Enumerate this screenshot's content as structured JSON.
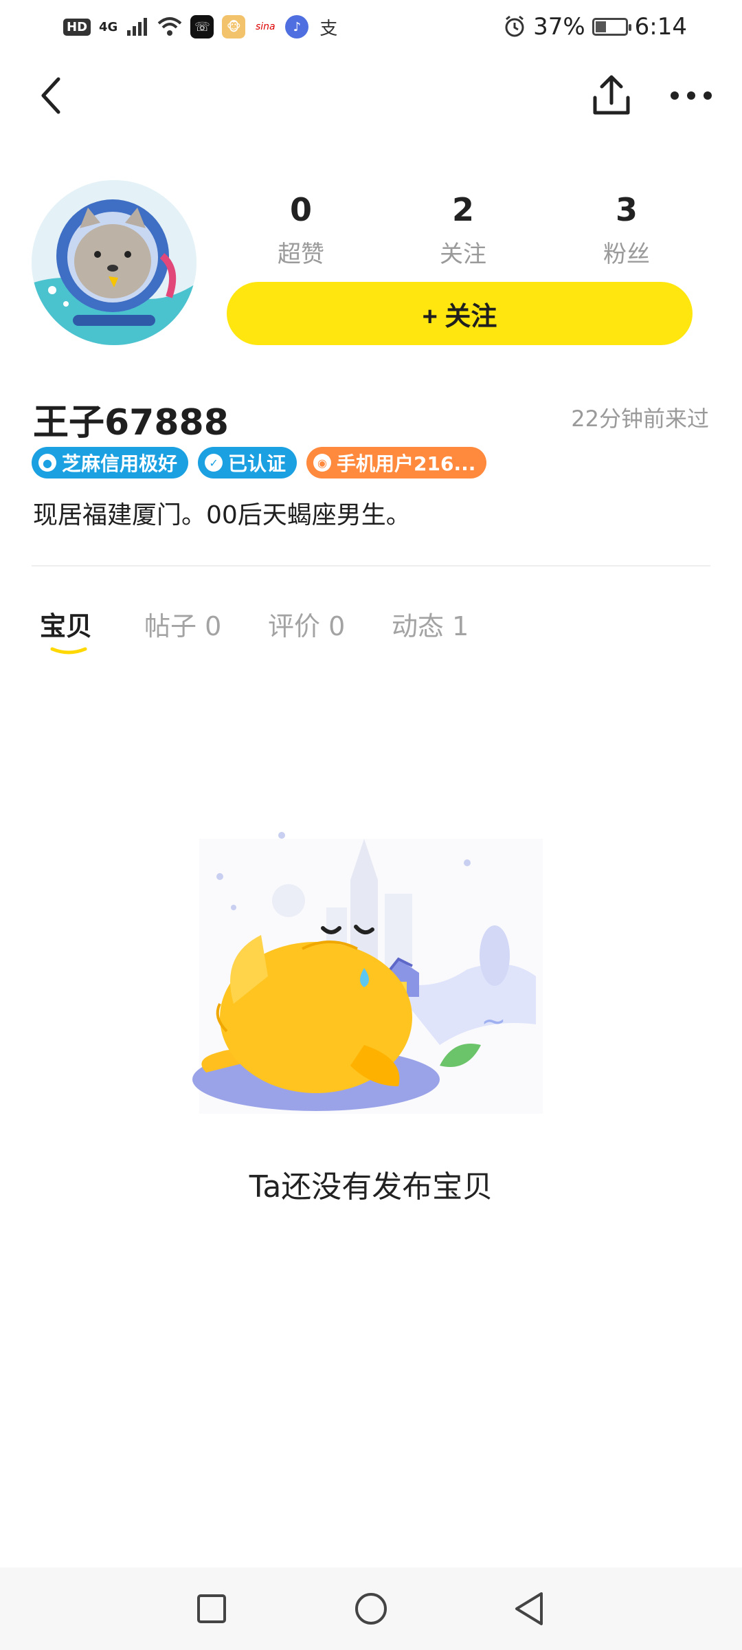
{
  "status_bar": {
    "network": "4G",
    "hd": "HD",
    "battery_percent": "37%",
    "battery_level": 0.37,
    "time": "6:14"
  },
  "nav": {
    "back_icon": "chevron-left-icon",
    "share_icon": "share-upload-icon",
    "more_icon": "more-dots-icon"
  },
  "profile": {
    "stats": [
      {
        "value": "0",
        "label": "超赞"
      },
      {
        "value": "2",
        "label": "关注"
      },
      {
        "value": "3",
        "label": "粉丝"
      }
    ],
    "follow_label": "+ 关注",
    "username": "王子67888",
    "last_visit": "22分钟前来过",
    "badges": [
      {
        "label": "芝麻信用极好",
        "color": "#1ba0e2",
        "icon": "sesame-icon"
      },
      {
        "label": "已认证",
        "color": "#1ba0e2",
        "icon": "verified-icon"
      },
      {
        "label": "手机用户216...",
        "color": "#ff8a3d",
        "icon": "weibo-icon"
      }
    ],
    "bio": "现居福建厦门。00后天蝎座男生。"
  },
  "tabs": [
    {
      "label": "宝贝",
      "active": true
    },
    {
      "label": "帖子 0",
      "active": false
    },
    {
      "label": "评价 0",
      "active": false
    },
    {
      "label": "动态 1",
      "active": false
    }
  ],
  "empty": {
    "message": "Ta还没有发布宝贝"
  },
  "colors": {
    "accent": "#ffe60f",
    "muted_text": "#9a9a9a",
    "blue_badge": "#1ba0e2",
    "orange_badge": "#ff8a3d"
  }
}
